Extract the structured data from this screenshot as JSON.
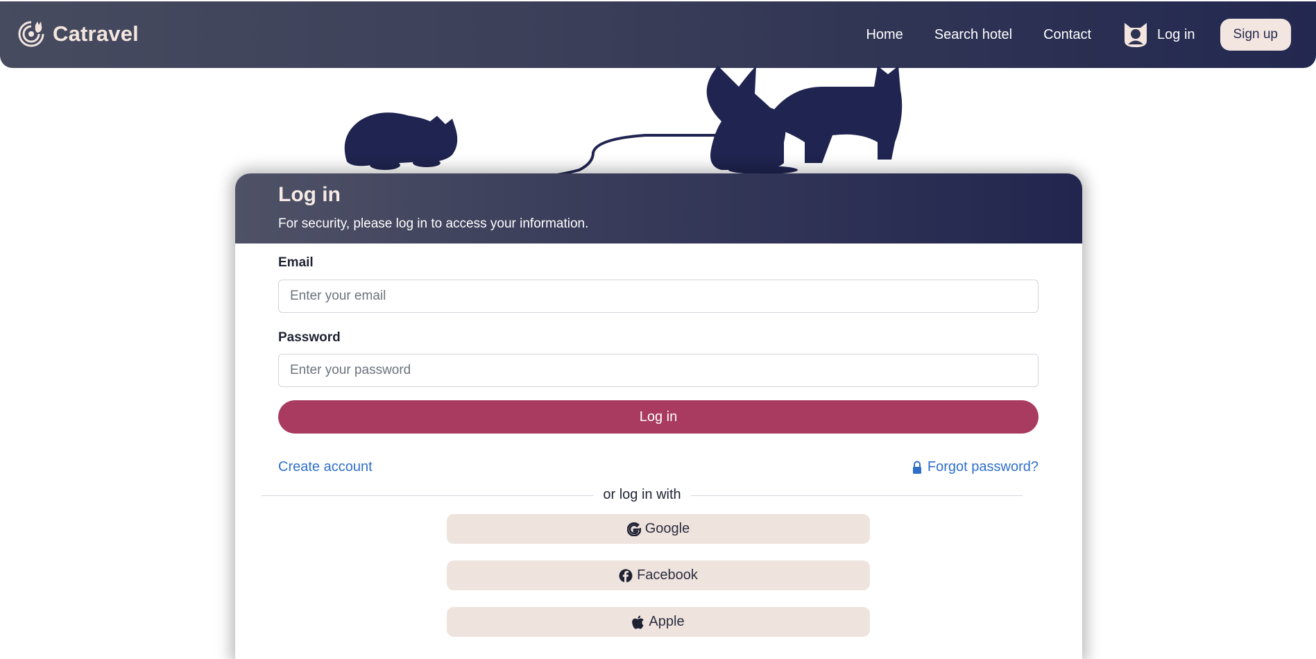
{
  "brand": {
    "name": "Catravel",
    "logo_icon": "cat-radar-logo-icon"
  },
  "nav": {
    "links": [
      "Home",
      "Search hotel",
      "Contact"
    ],
    "login_label": "Log in",
    "signup_label": "Sign up"
  },
  "card": {
    "title": "Log in",
    "subtitle": "For security, please log in to access your information."
  },
  "form": {
    "email_label": "Email",
    "email_placeholder": "Enter your email",
    "password_label": "Password",
    "password_placeholder": "Enter your password",
    "submit_label": "Log in",
    "create_account_label": "Create account",
    "forgot_password_label": "Forgot password?"
  },
  "social": {
    "divider_label": "or log in with",
    "buttons": [
      {
        "label": "Google",
        "icon": "google-icon"
      },
      {
        "label": "Facebook",
        "icon": "facebook-icon"
      },
      {
        "label": "Apple",
        "icon": "apple-icon"
      }
    ]
  },
  "colors": {
    "navbar": "#2f3352",
    "primary_button": "#a83b5f",
    "link": "#2f6fc9",
    "social_button_bg": "#efe3de",
    "signup_bg": "#f3e6e1",
    "cat_silhouette": "#1f2450"
  }
}
